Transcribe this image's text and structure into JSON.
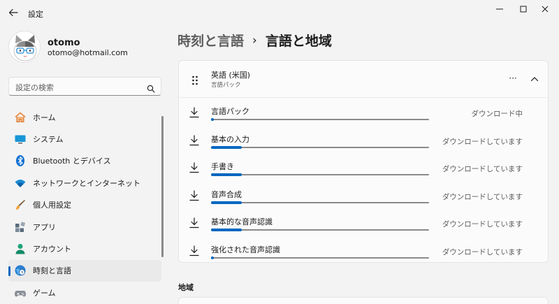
{
  "window": {
    "title": "設定"
  },
  "user": {
    "name": "otomo",
    "email": "otomo@hotmail.com"
  },
  "search": {
    "placeholder": "設定の検索"
  },
  "sidebar": {
    "items": [
      {
        "label": "ホーム",
        "icon": "home-icon"
      },
      {
        "label": "システム",
        "icon": "system-icon"
      },
      {
        "label": "Bluetooth とデバイス",
        "icon": "bluetooth-icon"
      },
      {
        "label": "ネットワークとインターネット",
        "icon": "wifi-icon"
      },
      {
        "label": "個人用設定",
        "icon": "brush-icon"
      },
      {
        "label": "アプリ",
        "icon": "apps-icon"
      },
      {
        "label": "アカウント",
        "icon": "account-icon"
      },
      {
        "label": "時刻と言語",
        "icon": "time-language-icon",
        "active": true
      },
      {
        "label": "ゲーム",
        "icon": "gamepad-icon"
      }
    ]
  },
  "breadcrumb": {
    "parent": "時刻と言語",
    "separator": "›",
    "current": "言語と地域"
  },
  "language": {
    "name": "英語 (米国)",
    "subtitle": "言語パック",
    "more": "···",
    "features": [
      {
        "label": "言語パック",
        "status": "ダウンロード中",
        "progress": 0.01
      },
      {
        "label": "基本の入力",
        "status": "ダウンロードしています",
        "progress": 0.14
      },
      {
        "label": "手書き",
        "status": "ダウンロードしています",
        "progress": 0.14
      },
      {
        "label": "音声合成",
        "status": "ダウンロードしています",
        "progress": 0.14
      },
      {
        "label": "基本的な音声認識",
        "status": "ダウンロードしています",
        "progress": 0.14
      },
      {
        "label": "強化された音声認識",
        "status": "ダウンロードしています",
        "progress": 0.01
      }
    ]
  },
  "region": {
    "heading": "地域"
  },
  "colors": {
    "accent": "#0067c0"
  }
}
